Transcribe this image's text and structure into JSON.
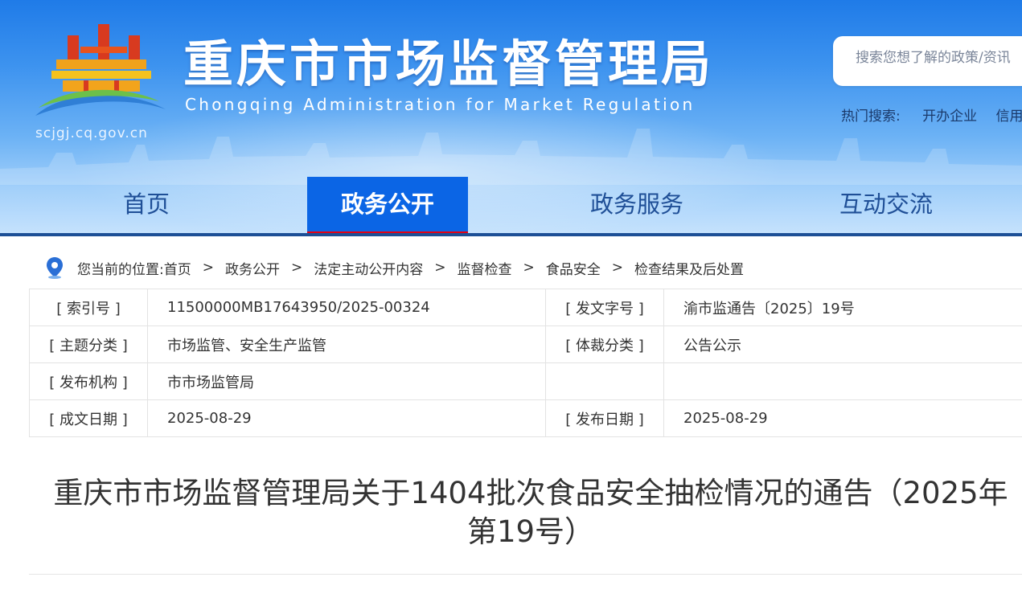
{
  "site": {
    "title": "重庆市市场监督管理局",
    "subtitle": "Chongqing Administration for Market Regulation",
    "url": "scjgj.cq.gov.cn"
  },
  "search": {
    "placeholder": "搜索您想了解的政策/资讯",
    "hot_label": "热门搜索:",
    "hot_items": [
      "开办企业",
      "信用"
    ]
  },
  "nav": {
    "items": [
      {
        "label": "首页",
        "active": false
      },
      {
        "label": "政务公开",
        "active": true
      },
      {
        "label": "政务服务",
        "active": false
      },
      {
        "label": "互动交流",
        "active": false
      }
    ]
  },
  "breadcrumb": {
    "prefix": "您当前的位置:",
    "items": [
      "首页",
      "政务公开",
      "法定主动公开内容",
      "监督检查",
      "食品安全",
      "检查结果及后处置"
    ],
    "separator": ">"
  },
  "info": {
    "rows": [
      {
        "k1": "[ 索引号 ]",
        "v1": "11500000MB17643950/2025-00324",
        "k2": "[ 发文字号 ]",
        "v2": "渝市监通告〔2025〕19号"
      },
      {
        "k1": "[ 主题分类 ]",
        "v1": "市场监管、安全生产监管",
        "k2": "[ 体裁分类 ]",
        "v2": "公告公示"
      },
      {
        "k1": "[ 发布机构 ]",
        "v1": "市市场监管局",
        "k2": "",
        "v2": ""
      },
      {
        "k1": "[ 成文日期 ]",
        "v1": "2025-08-29",
        "k2": "[ 发布日期 ]",
        "v2": "2025-08-29"
      }
    ]
  },
  "article": {
    "title": "重庆市市场监督管理局关于1404批次食品安全抽检情况的通告（2025年第19号）"
  },
  "colors": {
    "nav_active": "#0b65e5",
    "nav_active_underline": "#e60012",
    "nav_text": "#1f4f97",
    "header_top": "#1f7be8"
  }
}
